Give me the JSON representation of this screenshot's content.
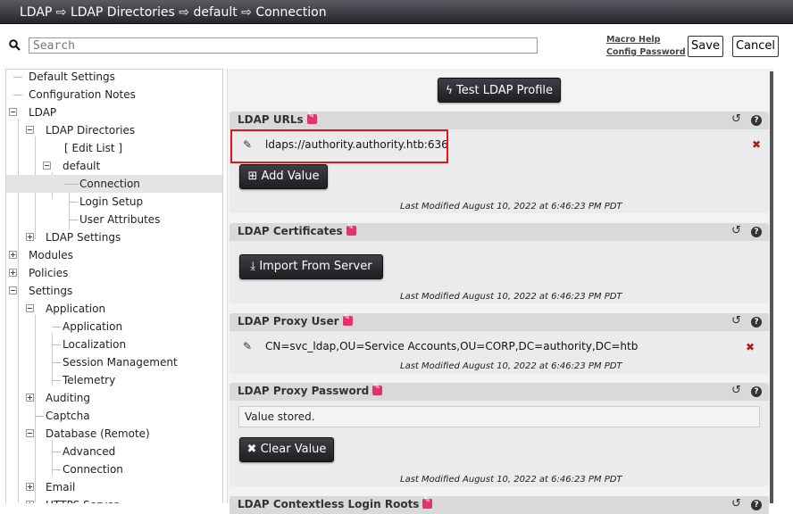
{
  "breadcrumb": "LDAP ⇨ LDAP Directories ⇨ default ⇨ Connection",
  "search": {
    "placeholder": "Search"
  },
  "links": {
    "macro_help": "Macro Help",
    "config_password": "Config Password"
  },
  "buttons": {
    "save": "Save",
    "cancel": "Cancel",
    "test_profile": "Test LDAP Profile",
    "add_value": "Add Value",
    "import_from_server": "Import From Server",
    "clear_value": "Clear Value"
  },
  "tree": [
    {
      "label": "Default Settings"
    },
    {
      "label": "Configuration Notes"
    },
    {
      "label": "LDAP"
    },
    {
      "label": "LDAP Directories"
    },
    {
      "label": "[ Edit List ]"
    },
    {
      "label": "default"
    },
    {
      "label": "Connection"
    },
    {
      "label": "Login Setup"
    },
    {
      "label": "User Attributes"
    },
    {
      "label": "LDAP Settings"
    },
    {
      "label": "Modules"
    },
    {
      "label": "Policies"
    },
    {
      "label": "Settings"
    },
    {
      "label": "Application"
    },
    {
      "label": "Application"
    },
    {
      "label": "Localization"
    },
    {
      "label": "Session Management"
    },
    {
      "label": "Telemetry"
    },
    {
      "label": "Auditing"
    },
    {
      "label": "Captcha"
    },
    {
      "label": "Database (Remote)"
    },
    {
      "label": "Advanced"
    },
    {
      "label": "Connection"
    },
    {
      "label": "Email"
    },
    {
      "label": "HTTPS Server"
    }
  ],
  "panels": {
    "ldap_urls": {
      "title": "LDAP URLs",
      "value": "ldaps://authority.authority.htb:636",
      "last_modified": "Last Modified August 10, 2022 at 6:46:23 PM PDT"
    },
    "ldap_certificates": {
      "title": "LDAP Certificates",
      "last_modified": "Last Modified August 10, 2022 at 6:46:23 PM PDT"
    },
    "ldap_proxy_user": {
      "title": "LDAP Proxy User",
      "value": "CN=svc_ldap,OU=Service Accounts,OU=CORP,DC=authority,DC=htb",
      "last_modified": "Last Modified August 10, 2022 at 6:46:23 PM PDT"
    },
    "ldap_proxy_password": {
      "title": "LDAP Proxy Password",
      "value": "Value stored.",
      "last_modified": "Last Modified August 10, 2022 at 6:46:23 PM PDT"
    },
    "ldap_contextless": {
      "title": "LDAP Contextless Login Roots"
    }
  },
  "colors": {
    "highlight": "#e3141f",
    "edit_badge": "#e2336c",
    "delete": "#b01a1a",
    "dark_button": "#2b2c31"
  }
}
